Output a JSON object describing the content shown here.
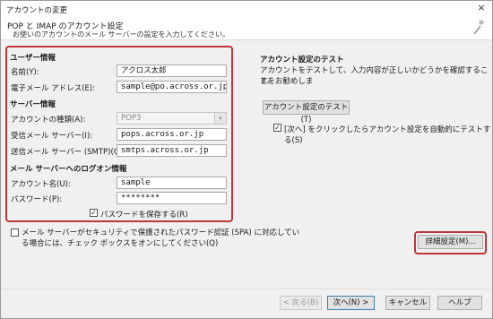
{
  "window": {
    "title": "アカウントの変更",
    "close_glyph": "×"
  },
  "header": {
    "title": "POP と IMAP のアカウント設定",
    "subtitle": "お使いのアカウントのメール サーバーの設定を入力してください。"
  },
  "user_info": {
    "heading": "ユーザー情報",
    "name_label": "名前(Y):",
    "name_value": "アクロス太郎",
    "email_label": "電子メール アドレス(E):",
    "email_value": "sample@po.across.or.jp"
  },
  "server_info": {
    "heading": "サーバー情報",
    "account_type_label": "アカウントの種類(A):",
    "account_type_value": "POP3",
    "incoming_label": "受信メール サーバー(I):",
    "incoming_value": "pops.across.or.jp",
    "outgoing_label": "送信メール サーバー (SMTP)(O):",
    "outgoing_value": "smtps.across.or.jp"
  },
  "logon_info": {
    "heading": "メール サーバーへのログオン情報",
    "account_name_label": "アカウント名(U):",
    "account_name_value": "sample",
    "password_label": "パスワード(P):",
    "password_value": "********",
    "remember_password_label": "パスワードを保存する(R)",
    "remember_password_checked": true
  },
  "spa": {
    "line1": "メール サーバーがセキュリティで保護されたパスワード認証 (SPA) に対応してい",
    "line2": "る場合には、チェック ボックスをオンにしてください(Q)",
    "checked": false
  },
  "test": {
    "heading": "アカウント設定のテスト",
    "desc_line1": "アカウントをテストして、入力内容が正しいかどうかを確認することをお勧めしま",
    "desc_line2": "す。",
    "button_label": "アカウント設定のテスト(T)",
    "auto_test_label": "[次へ] をクリックしたらアカウント設定を自動的にテストする(S)",
    "auto_test_checked": true
  },
  "more_settings_label": "詳細設定(M)...",
  "footer": {
    "back_label": "< 戻る(B)",
    "next_label": "次へ(N) >",
    "cancel_label": "キャンセル",
    "help_label": "ヘルプ"
  },
  "icons": {
    "check_glyph": "✓",
    "dropdown_glyph": "▾"
  },
  "colors": {
    "highlight_border": "#c0343b",
    "panel_bg": "#f0f0f0",
    "button_bg": "#e1e1e1",
    "primary_border": "#3c7fb1"
  }
}
